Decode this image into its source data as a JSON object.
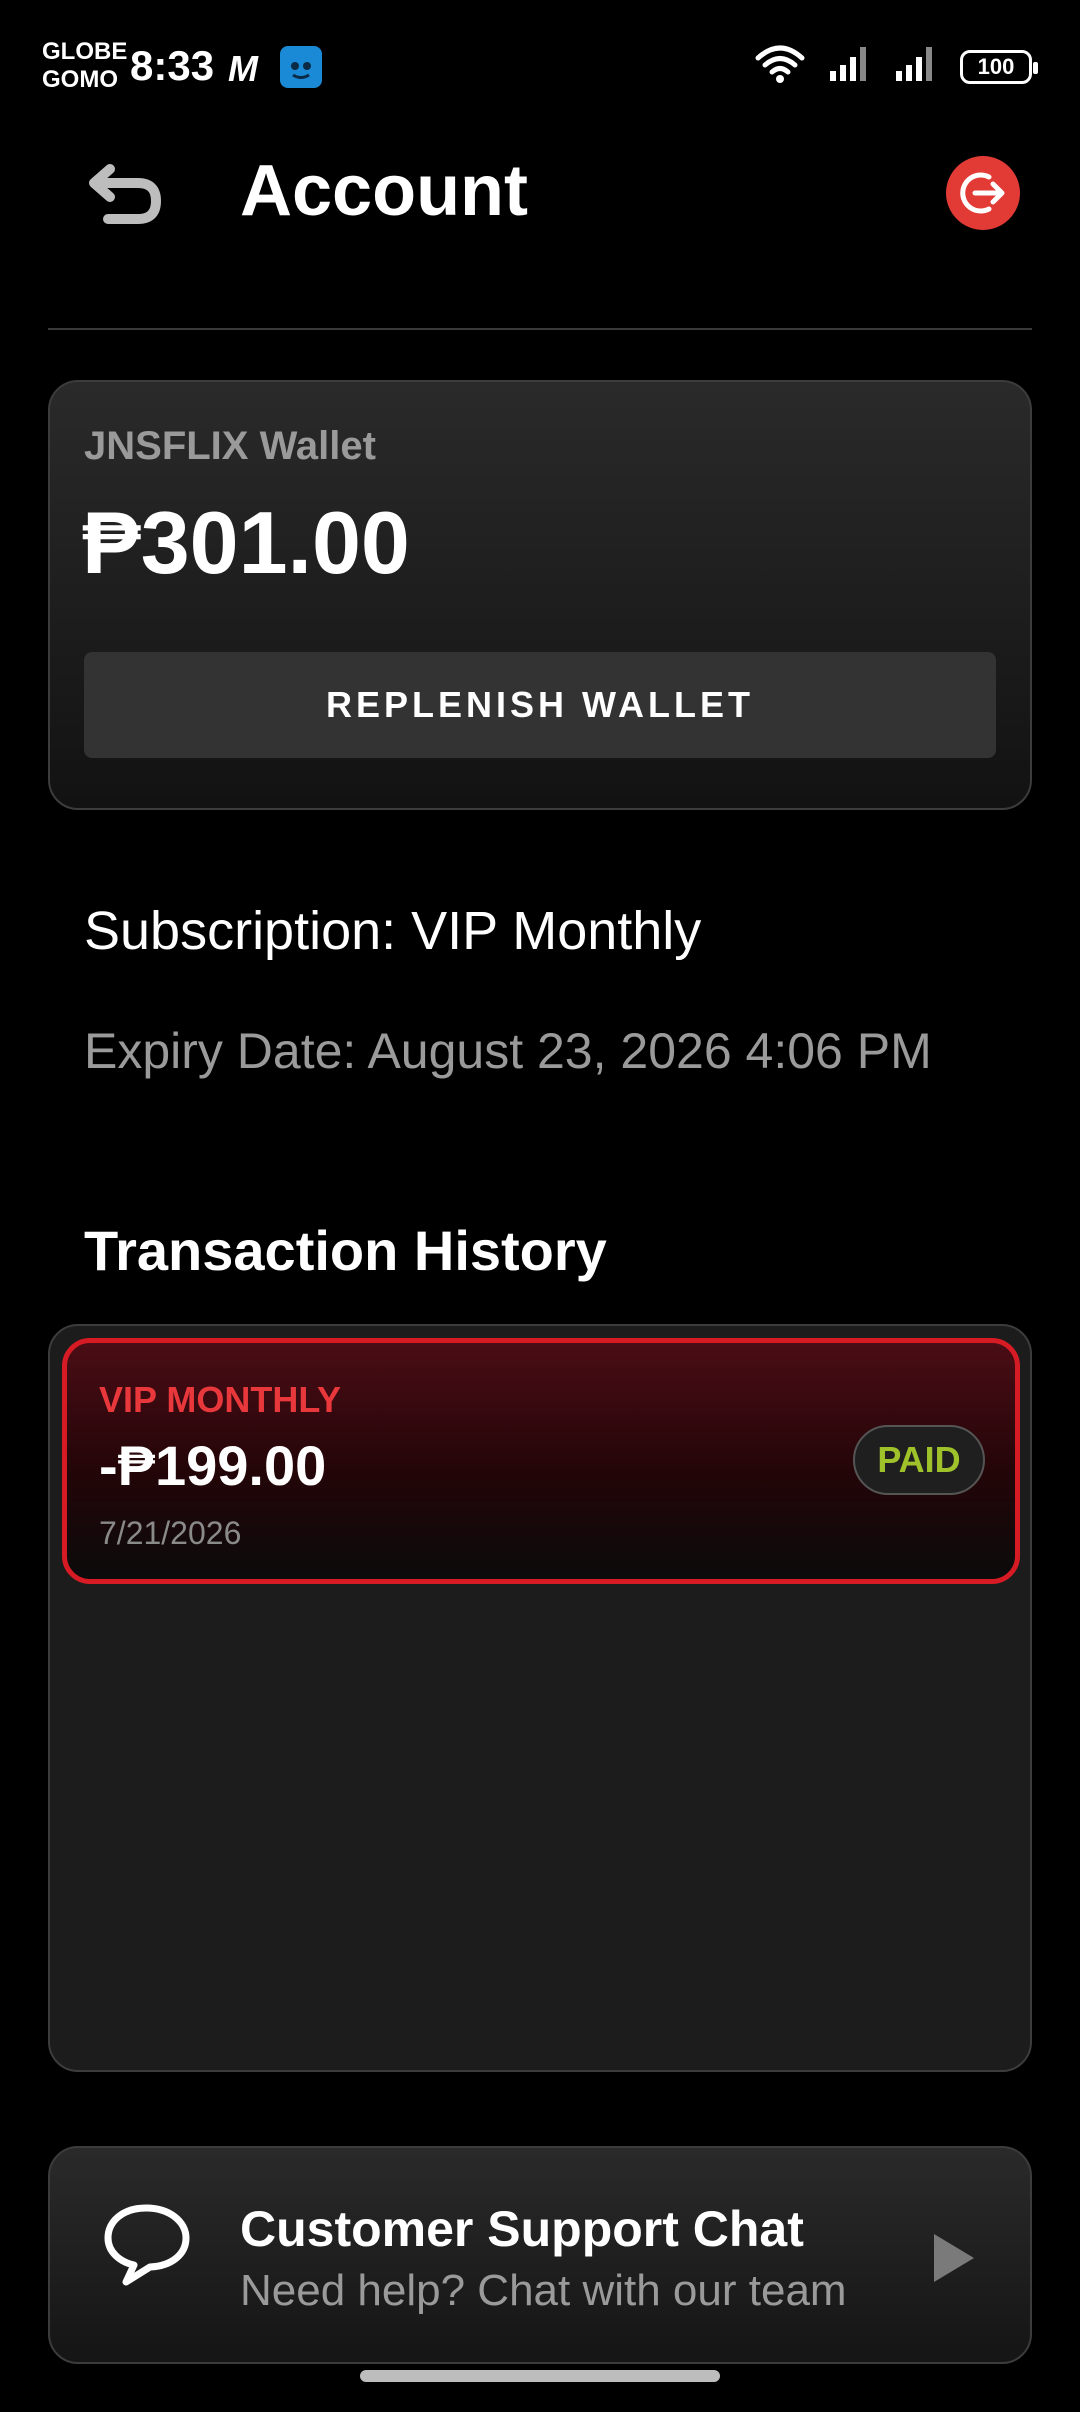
{
  "status_bar": {
    "carrier_line1": "GLOBE",
    "carrier_line2": "GOMO",
    "time": "8:33",
    "m_icon": "M",
    "battery": "100",
    "icons": [
      "m-logo-icon",
      "app-icon",
      "wifi-icon",
      "signal-icon",
      "battery-icon"
    ]
  },
  "header": {
    "title": "Account",
    "back_icon": "back-arrow-icon",
    "logout_icon": "logout-icon",
    "logout_color": "#e23a35"
  },
  "wallet": {
    "label": "JNSFLIX Wallet",
    "balance": "₱301.00",
    "replenish_label": "REPLENISH WALLET"
  },
  "subscription": {
    "text": "Subscription: VIP Monthly",
    "expiry": "Expiry Date: August 23, 2026 4:06 PM"
  },
  "transactions": {
    "title": "Transaction History",
    "items": [
      {
        "name": "VIP MONTHLY",
        "amount": "-₱199.00",
        "date": "7/21/2026",
        "status": "PAID"
      }
    ],
    "accent_color": "#d71b24",
    "paid_color": "#9fc22a"
  },
  "support": {
    "title": "Customer Support Chat",
    "subtitle": "Need help? Chat with our team",
    "chat_icon": "chat-bubble-icon",
    "arrow_icon": "play-arrow-icon"
  }
}
